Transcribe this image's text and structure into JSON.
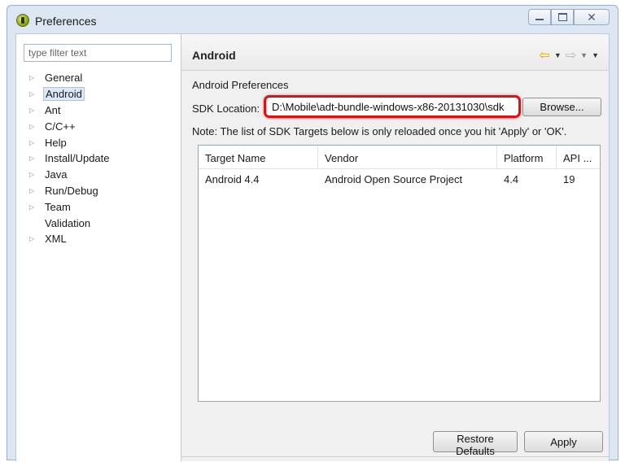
{
  "window": {
    "title": "Preferences",
    "icon": "eclipse-icon",
    "controls": {
      "minimize": "minimize-icon",
      "maximize": "maximize-icon",
      "close": "✕"
    }
  },
  "sidebar": {
    "filter_placeholder": "type filter text",
    "items": [
      {
        "label": "General",
        "expandable": true
      },
      {
        "label": "Android",
        "expandable": true,
        "selected": true
      },
      {
        "label": "Ant",
        "expandable": true
      },
      {
        "label": "C/C++",
        "expandable": true
      },
      {
        "label": "Help",
        "expandable": true
      },
      {
        "label": "Install/Update",
        "expandable": true
      },
      {
        "label": "Java",
        "expandable": true
      },
      {
        "label": "Run/Debug",
        "expandable": true
      },
      {
        "label": "Team",
        "expandable": true
      },
      {
        "label": "Validation",
        "expandable": false
      },
      {
        "label": "XML",
        "expandable": true
      }
    ]
  },
  "page": {
    "title": "Android",
    "section_label": "Android Preferences",
    "sdk_label": "SDK Location:",
    "sdk_value": "D:\\Mobile\\adt-bundle-windows-x86-20131030\\sdk",
    "browse_label": "Browse...",
    "note": "Note: The list of SDK Targets below is only reloaded once you hit 'Apply' or 'OK'.",
    "highlight_color": "#e01010"
  },
  "table": {
    "columns": [
      "Target Name",
      "Vendor",
      "Platform",
      "API ..."
    ],
    "rows": [
      [
        "Android 4.4",
        "Android Open Source Project",
        "4.4",
        "19"
      ]
    ]
  },
  "footer": {
    "restore_label": "Restore Defaults",
    "apply_label": "Apply"
  }
}
